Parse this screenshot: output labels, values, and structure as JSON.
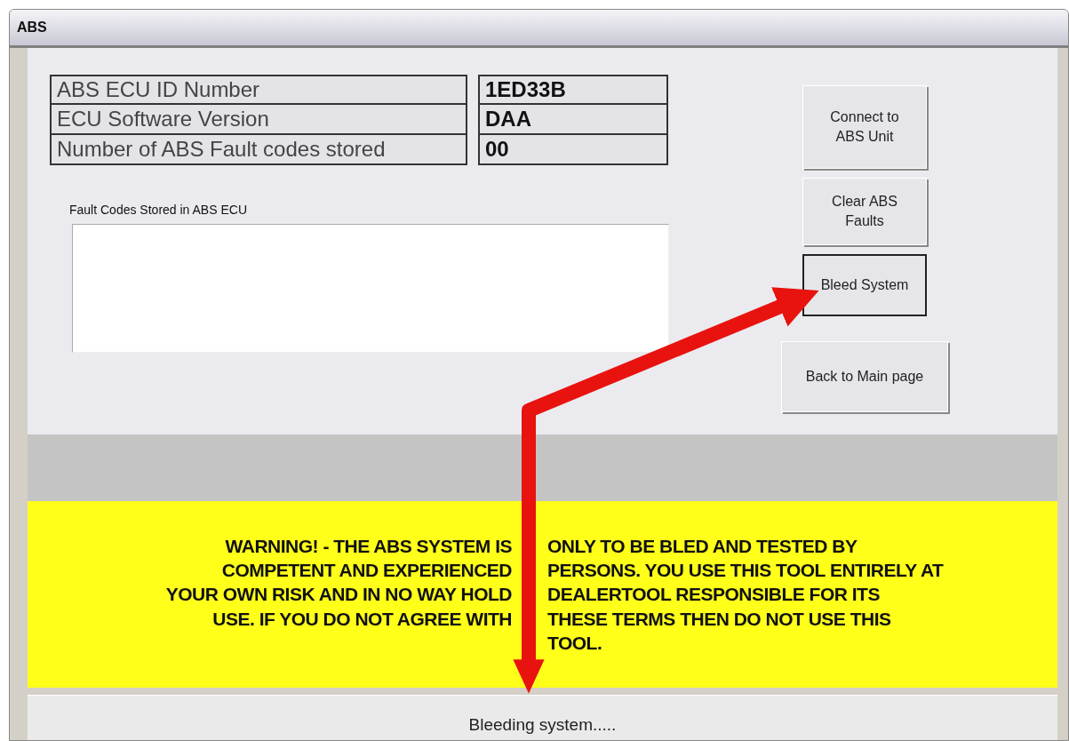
{
  "window": {
    "title": "ABS"
  },
  "info_rows": [
    {
      "label": "ABS ECU ID Number",
      "value": "1ED33B"
    },
    {
      "label": "ECU Software Version",
      "value": "DAA"
    },
    {
      "label": "Number of ABS Fault codes stored",
      "value": "00"
    }
  ],
  "fault_codes": {
    "label": "Fault Codes Stored in ABS ECU"
  },
  "buttons": [
    {
      "label": "Connect to ABS Unit",
      "focused": false
    },
    {
      "label": "Clear ABS Faults",
      "focused": false
    },
    {
      "label": "Bleed System",
      "focused": true
    },
    {
      "label": "Back to Main page",
      "focused": false
    }
  ],
  "warning_lines": [
    {
      "left": "WARNING! - THE ABS SYSTEM IS",
      "right": "ONLY TO BE BLED AND TESTED BY"
    },
    {
      "left": "COMPETENT AND EXPERIENCED",
      "right": "PERSONS. YOU USE THIS TOOL ENTIRELY AT"
    },
    {
      "left": "YOUR OWN RISK AND IN NO WAY HOLD",
      "right": "DEALERTOOL RESPONSIBLE FOR ITS"
    },
    {
      "left": "USE. IF YOU DO NOT AGREE WITH",
      "right": "THESE TERMS THEN DO NOT USE THIS"
    },
    {
      "right": "TOOL."
    }
  ],
  "status_bar": "Bleeding system....."
}
